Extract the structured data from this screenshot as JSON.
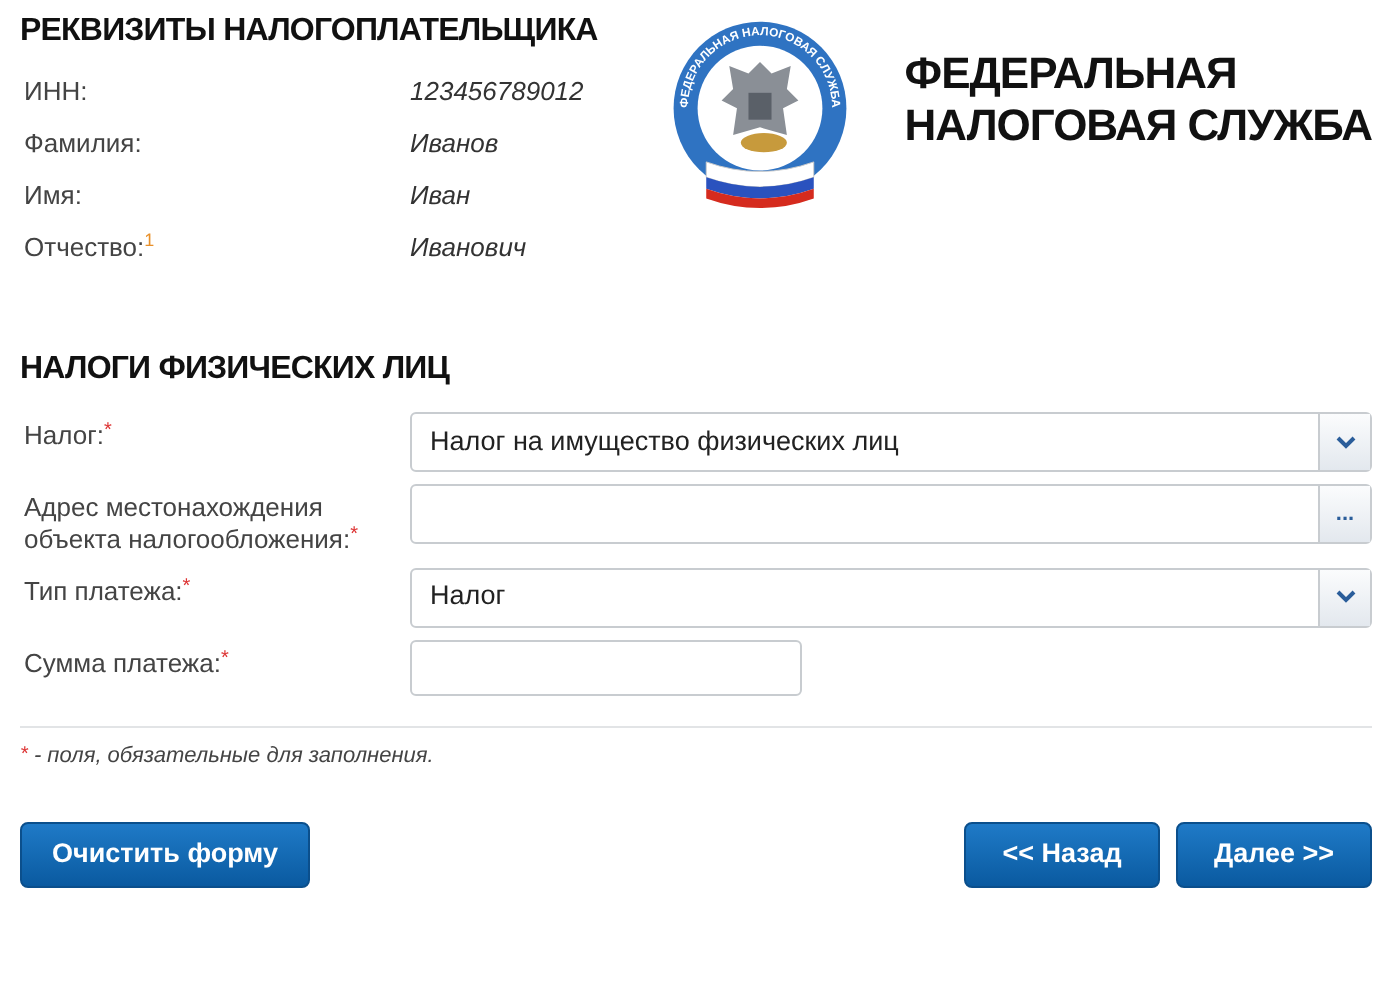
{
  "taxpayer": {
    "title": "РЕКВИЗИТЫ НАЛОГОПЛАТЕЛЬЩИКА",
    "fields": [
      {
        "label": "ИНН:",
        "value": "123456789012"
      },
      {
        "label": "Фамилия:",
        "value": "Иванов"
      },
      {
        "label": "Имя:",
        "value": "Иван"
      },
      {
        "label": "Отчество:",
        "note": "1",
        "value": "Иванович"
      }
    ]
  },
  "logo": {
    "emblem_text": "ФЕДЕРАЛЬНАЯ НАЛОГОВАЯ СЛУЖБА",
    "name_lines": [
      "ФЕДЕРАЛЬНАЯ",
      "НАЛОГОВАЯ СЛУЖБА"
    ]
  },
  "taxes": {
    "title": "НАЛОГИ ФИЗИЧЕСКИХ ЛИЦ",
    "fields": [
      {
        "kind": "select",
        "label": "Налог:",
        "required": true,
        "value": "Налог на имущество физических лиц"
      },
      {
        "kind": "lookup",
        "label": "Адрес местонахождения объекта налогообложения:",
        "required": true,
        "button": "..."
      },
      {
        "kind": "select",
        "label": "Тип платежа:",
        "required": true,
        "value": "Налог"
      },
      {
        "kind": "text",
        "label": "Сумма платежа:",
        "required": true
      }
    ]
  },
  "footnote": {
    "mark": "*",
    "text": "- поля, обязательные для заполнения."
  },
  "buttons": {
    "left": [
      "Очистить форму"
    ],
    "right": [
      "<< Назад",
      "Далее >>"
    ]
  }
}
